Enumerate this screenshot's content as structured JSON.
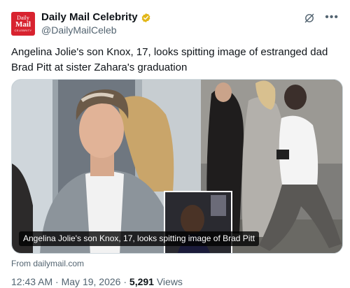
{
  "account": {
    "avatar_line1": "Daily",
    "avatar_line2": "Mail",
    "avatar_line3": "CELEBRITY",
    "display_name": "Daily Mail Celebrity",
    "handle": "@DailyMailCeleb",
    "verified_badge_color": "#e2b719",
    "brand_color": "#d8232f"
  },
  "header_icons": {
    "grok": "grok-icon",
    "more": "more-options-icon",
    "more_glyph": "•••"
  },
  "tweet": {
    "text": "Angelina Jolie's son Knox, 17, looks spitting image of estranged dad Brad Pitt at sister Zahara's graduation"
  },
  "media": {
    "caption": "Angelina Jolie's son Knox, 17, looks spitting image of Brad Pitt"
  },
  "card": {
    "source": "From dailymail.com"
  },
  "meta": {
    "time": "12:43 AM",
    "separator1": "·",
    "date": "May 19, 2026",
    "separator2": "·",
    "views_count": "5,291",
    "views_label": "Views"
  }
}
